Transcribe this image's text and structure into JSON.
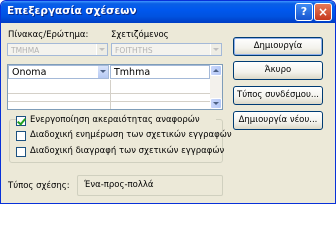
{
  "window": {
    "title": "Επεξεργασία σχέσεων",
    "help_glyph": "?",
    "close_glyph": "×"
  },
  "tables": {
    "left_header": "Πίνακας/Ερώτημα:",
    "right_header": "Σχετιζόμενος",
    "left_table": "TMHMA",
    "right_table": "FOITHTHS"
  },
  "grid": {
    "rows": [
      {
        "left": "Onoma",
        "right": "Tmhma"
      }
    ]
  },
  "options": {
    "enforce_integrity": {
      "label": "Ενεργοποίηση ακεραιότητας αναφορών",
      "checked": true
    },
    "cascade_update": {
      "label": "Διαδοχική ενημέρωση των σχετικών εγγραφών",
      "checked": false
    },
    "cascade_delete": {
      "label": "Διαδοχική διαγραφή των σχετικών εγγραφών",
      "checked": false
    }
  },
  "relationship": {
    "label": "Τύπος σχέσης:",
    "value": "Ένα-προς-πολλά"
  },
  "buttons": {
    "create": "Δημιουργία",
    "cancel": "Άκυρο",
    "join_type": "Τύπος συνδέσμου...",
    "create_new": "Δημιουργία νέου..."
  }
}
